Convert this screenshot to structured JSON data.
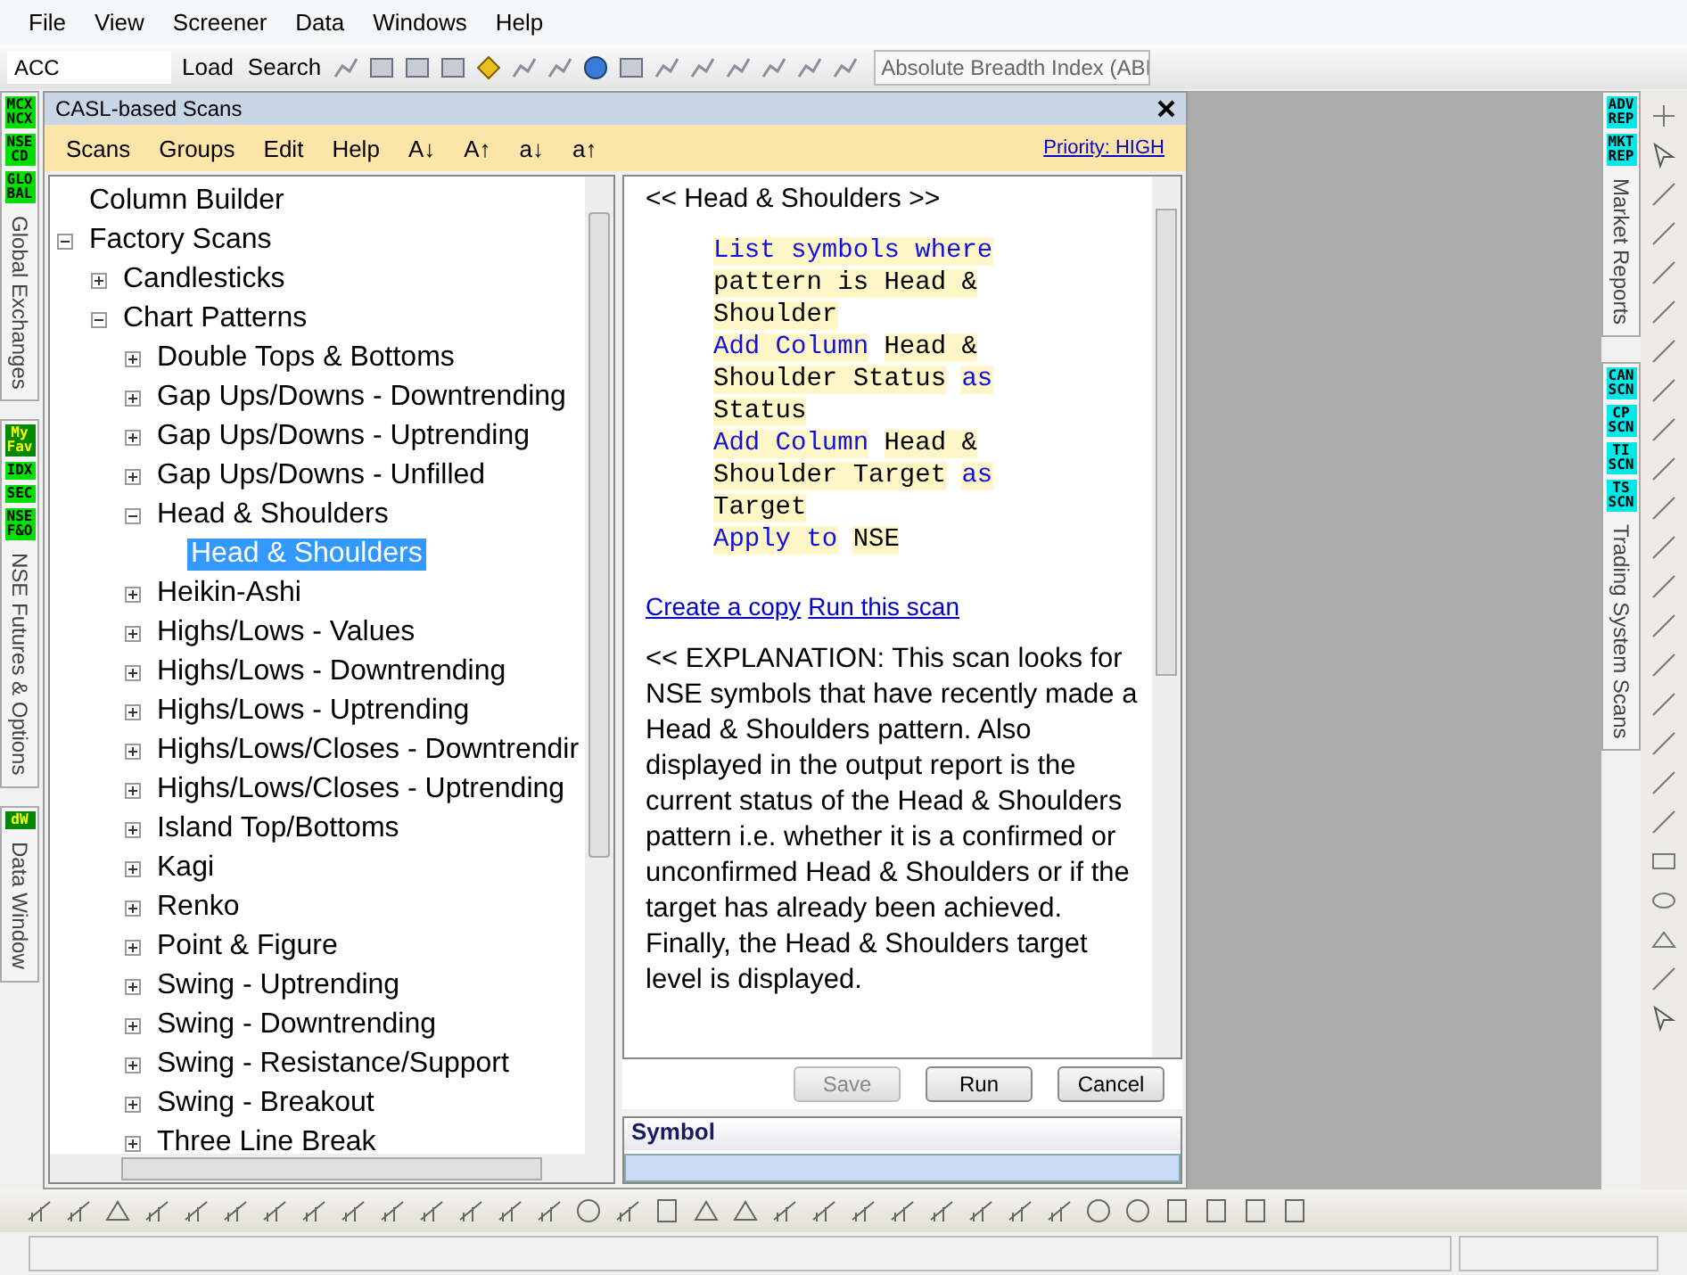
{
  "menu": [
    "File",
    "View",
    "Screener",
    "Data",
    "Windows",
    "Help"
  ],
  "toolbar": {
    "symbol": "ACC",
    "buttons": [
      "Load",
      "Search"
    ],
    "indicator": "Absolute Breadth Index (ABI"
  },
  "left_tabs": [
    {
      "badges": [
        {
          "text": "MCX NCX",
          "kind": "green"
        },
        {
          "text": "NSE CD",
          "kind": "green"
        },
        {
          "text": "GLO BAL",
          "kind": "green"
        }
      ],
      "label": "Global Exchanges"
    },
    {
      "badges": [
        {
          "text": "My Fav",
          "kind": "dark"
        },
        {
          "text": "IDX",
          "kind": "green"
        },
        {
          "text": "SEC",
          "kind": "green"
        },
        {
          "text": "NSE F&O",
          "kind": "green"
        }
      ],
      "label": "NSE Futures & Options"
    },
    {
      "badges": [
        {
          "text": "dW",
          "kind": "dark"
        }
      ],
      "label": "Data Window"
    }
  ],
  "panel": {
    "title": "CASL-based Scans",
    "menu": [
      "Scans",
      "Groups",
      "Edit",
      "Help",
      "A↓",
      "A↑",
      "a↓",
      "a↑"
    ],
    "priority": "Priority: HIGH"
  },
  "tree": [
    {
      "label": "Column Builder"
    },
    {
      "label": "Factory Scans",
      "expanded": true,
      "children": [
        {
          "label": "Candlesticks",
          "expanded": false
        },
        {
          "label": "Chart Patterns",
          "expanded": true,
          "children": [
            {
              "label": "Double Tops & Bottoms",
              "expanded": false
            },
            {
              "label": "Gap Ups/Downs - Downtrending",
              "expanded": false
            },
            {
              "label": "Gap Ups/Downs - Uptrending",
              "expanded": false
            },
            {
              "label": "Gap Ups/Downs - Unfilled",
              "expanded": false
            },
            {
              "label": "Head & Shoulders",
              "expanded": true,
              "children": [
                {
                  "label": "Head & Shoulders",
                  "selected": true
                }
              ]
            },
            {
              "label": "Heikin-Ashi",
              "expanded": false
            },
            {
              "label": "Highs/Lows - Values",
              "expanded": false
            },
            {
              "label": "Highs/Lows - Downtrending",
              "expanded": false
            },
            {
              "label": "Highs/Lows - Uptrending",
              "expanded": false
            },
            {
              "label": "Highs/Lows/Closes - Downtrendir",
              "expanded": false
            },
            {
              "label": "Highs/Lows/Closes - Uptrending",
              "expanded": false
            },
            {
              "label": "Island Top/Bottoms",
              "expanded": false
            },
            {
              "label": "Kagi",
              "expanded": false
            },
            {
              "label": "Renko",
              "expanded": false
            },
            {
              "label": "Point & Figure",
              "expanded": false
            },
            {
              "label": "Swing - Uptrending",
              "expanded": false
            },
            {
              "label": "Swing - Downtrending",
              "expanded": false
            },
            {
              "label": "Swing - Resistance/Support",
              "expanded": false
            },
            {
              "label": "Swing - Breakout",
              "expanded": false
            },
            {
              "label": "Three Line Break",
              "expanded": false
            }
          ]
        }
      ]
    }
  ],
  "script": {
    "heading": "<< Head & Shoulders >>",
    "statements": [
      [
        {
          "text": "List symbols where",
          "keyword": true
        },
        {
          "text": "pattern is Head & Shoulder",
          "keyword": false
        }
      ],
      [
        {
          "text": "Add Column",
          "keyword": true
        },
        {
          "text": "Head & Shoulder Status",
          "keyword": false
        },
        {
          "text": "as",
          "keyword": true
        },
        {
          "text": "Status",
          "keyword": false
        }
      ],
      [
        {
          "text": "Add Column",
          "keyword": true
        },
        {
          "text": "Head & Shoulder Target",
          "keyword": false
        },
        {
          "text": "as",
          "keyword": true
        },
        {
          "text": "Target",
          "keyword": false
        }
      ],
      [
        {
          "text": "Apply to",
          "keyword": true
        },
        {
          "text": "NSE",
          "keyword": false
        }
      ]
    ],
    "links": [
      "Create a copy",
      "Run this scan"
    ],
    "explanation": "<< EXPLANATION: This scan looks for NSE symbols that have recently made a Head & Shoulders pattern. Also displayed in the output report is the current status of the Head & Shoulders pattern i.e. whether it is a confirmed or unconfirmed Head & Shoulders or if the target has already been achieved. Finally, the Head & Shoulders target level is displayed."
  },
  "buttons": [
    {
      "label": "Save",
      "disabled": true
    },
    {
      "label": "Run",
      "disabled": false
    },
    {
      "label": "Cancel",
      "disabled": false
    }
  ],
  "results": {
    "column": "Symbol"
  },
  "right_tabs": [
    {
      "badges": [
        "ADV REP",
        "MKT REP"
      ],
      "label": "Market Reports"
    },
    {
      "badges": [
        "CAN SCN",
        "CP SCN",
        "TI SCN",
        "TS SCN"
      ],
      "label": "Trading System Scans"
    }
  ]
}
